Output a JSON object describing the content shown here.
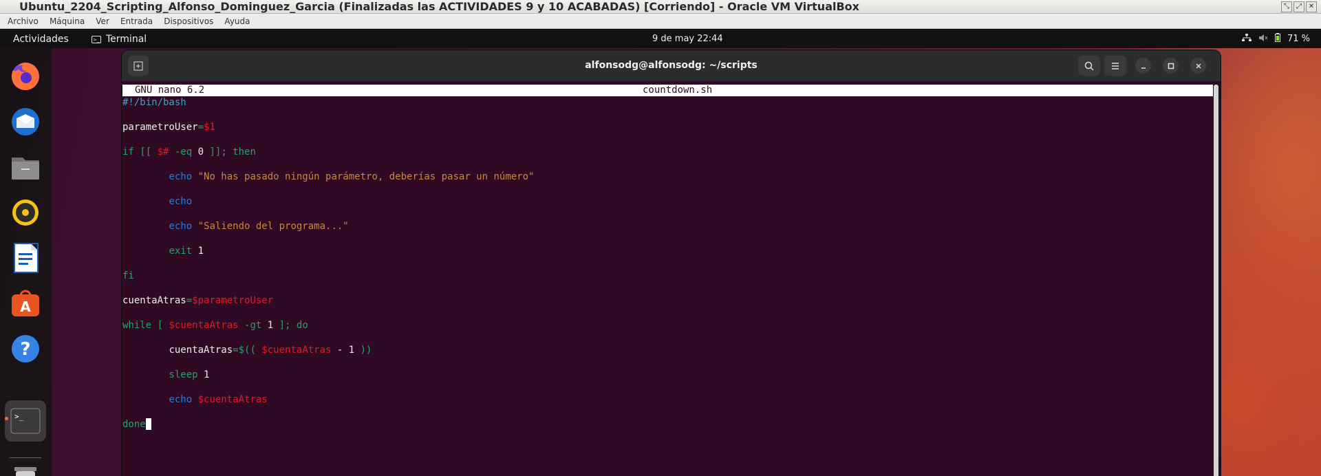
{
  "vbox": {
    "title": "Ubuntu_2204_Scripting_Alfonso_Dominguez_Garcia (Finalizadas las ACTIVIDADES 9 y 10 ACABADAS) [Corriendo] - Oracle VM VirtualBox",
    "menu": [
      "Archivo",
      "Máquina",
      "Ver",
      "Entrada",
      "Dispositivos",
      "Ayuda"
    ]
  },
  "topbar": {
    "activities": "Actividades",
    "app": "Terminal",
    "clock": "9 de may  22:44",
    "battery": "71 %"
  },
  "dock": {
    "items": [
      "firefox-icon",
      "thunderbird-icon",
      "files-icon",
      "rhythmbox-icon",
      "writer-icon",
      "app-center-icon",
      "help-icon",
      "terminal-icon",
      "trash-icon"
    ]
  },
  "terminal": {
    "title": "alfonsodg@alfonsodg: ~/scripts",
    "nano_version": "GNU nano 6.2",
    "filename": "countdown.sh"
  },
  "code": {
    "l1": "#!/bin/bash",
    "l2a": "parametroUser",
    "l2b": "=",
    "l2c": "$1",
    "l3a": "if [[ ",
    "l3b": "$#",
    "l3c": " -eq ",
    "l3d": "0",
    "l3e": " ]]; then",
    "l4a": "echo",
    "l4b": "\"No has pasado ningún parámetro, deberías pasar un número\"",
    "l5a": "echo",
    "l6a": "echo",
    "l6b": "\"Saliendo del programa...\"",
    "l7a": "exit",
    "l7b": "1",
    "l8": "fi",
    "l9a": "cuentaAtras",
    "l9b": "=",
    "l9c": "$parametroUser",
    "l10a": "while [ ",
    "l10b": "$cuentaAtras",
    "l10c": " -gt ",
    "l10d": "1",
    "l10e": " ]; do",
    "l11a": "cuentaAtras",
    "l11b": "=$(( ",
    "l11c": "$cuentaAtras",
    "l11d": " - ",
    "l11e": "1",
    "l11f": " ))",
    "l12a": "sleep",
    "l12b": "1",
    "l13a": "echo",
    "l13b": "$cuentaAtras",
    "l14": "done"
  }
}
